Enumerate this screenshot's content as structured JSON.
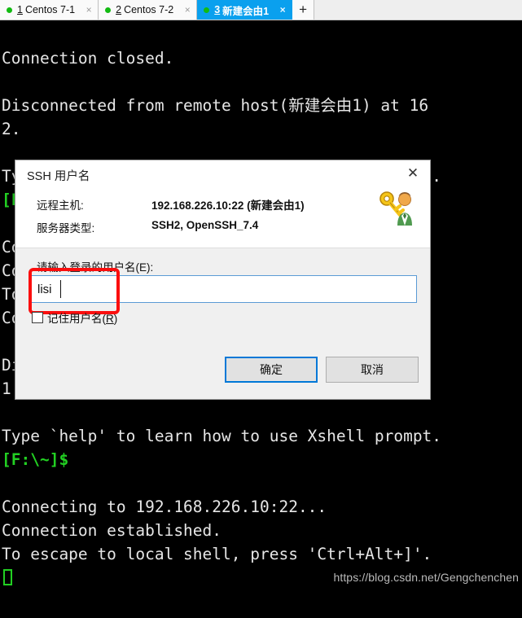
{
  "tabbar": {
    "tabs": [
      {
        "num": "1",
        "label": "Centos 7-1",
        "close": "×",
        "active": false
      },
      {
        "num": "2",
        "label": "Centos 7-2",
        "close": "×",
        "active": false
      },
      {
        "num": "3",
        "label": "新建会由1",
        "close": "×",
        "active": true
      }
    ],
    "new_tab_label": "+"
  },
  "terminal": {
    "lines": [
      {
        "text": "",
        "green": false
      },
      {
        "text": "Connection closed.",
        "green": false
      },
      {
        "text": "",
        "green": false
      },
      {
        "text": "Disconnected from remote host(新建会由1) at 16",
        "green": false
      },
      {
        "text": "2.",
        "green": false
      },
      {
        "text": "",
        "green": false
      },
      {
        "text": "Type `help' to learn how to use Xshell prompt.",
        "green": false
      },
      {
        "text": "[F:\\~]$",
        "green": true
      },
      {
        "text": "",
        "green": false
      },
      {
        "text": "Connecting to 192.168.226.10:22...",
        "green": false
      },
      {
        "text": "Connection established.",
        "green": false
      },
      {
        "text": "To escape to local shell, press 'Ctrl+Alt+]'.",
        "green": false
      },
      {
        "text": "Connection closed.",
        "green": false
      },
      {
        "text": "",
        "green": false
      },
      {
        "text": "Disconnected from remote host(新建会由1) at 16",
        "green": false
      },
      {
        "text": "1.",
        "green": false
      },
      {
        "text": "",
        "green": false
      },
      {
        "text": "Type `help' to learn how to use Xshell prompt.",
        "green": false
      },
      {
        "text": "[F:\\~]$",
        "green": true
      },
      {
        "text": "",
        "green": false
      },
      {
        "text": "Connecting to 192.168.226.10:22...",
        "green": false
      },
      {
        "text": "Connection established.",
        "green": false
      },
      {
        "text": "To escape to local shell, press 'Ctrl+Alt+]'.",
        "green": false
      }
    ],
    "watermark": "https://blog.csdn.net/Gengchenchen",
    "fg_color": "#e6e6e6",
    "green_color": "#22d022",
    "bg_color": "#000000"
  },
  "dialog": {
    "title": "SSH 用户名",
    "close_label": "✕",
    "host_label": "远程主机:",
    "host_value": "192.168.226.10:22 (新建会由1)",
    "type_label": "服务器类型:",
    "type_value": "SSH2, OpenSSH_7.4",
    "prompt_label": "请输入登录的用户名(E):",
    "username_value": "lisi",
    "username_placeholder": "",
    "remember_label_pre": "记住用户名(",
    "remember_label_key": "R",
    "remember_label_post": "):",
    "remember_checked": false,
    "ok_label": "确定",
    "cancel_label": "取消",
    "accent_color": "#0078d7",
    "highlight_color": "#fb0e0e"
  }
}
